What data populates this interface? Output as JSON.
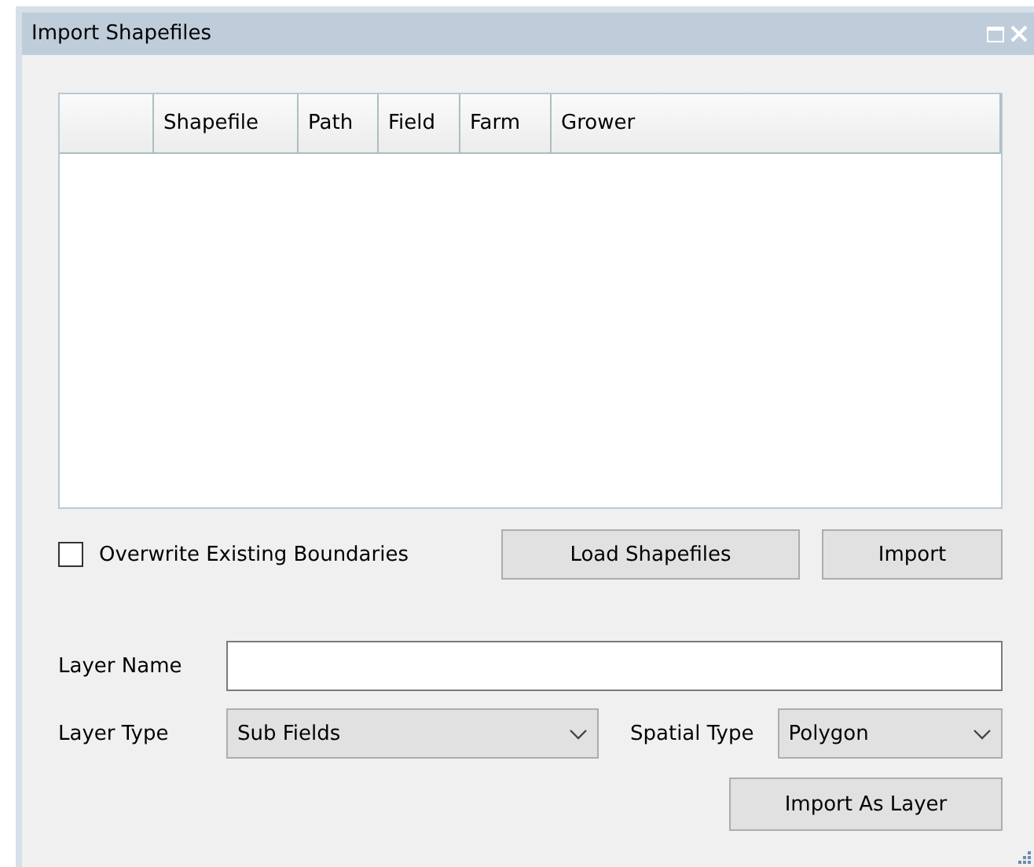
{
  "window": {
    "title": "Import Shapefiles"
  },
  "table": {
    "columns": [
      "Shapefile",
      "Path",
      "Field",
      "Farm",
      "Grower"
    ]
  },
  "overwrite": {
    "label": "Overwrite Existing Boundaries",
    "checked": false
  },
  "buttons": {
    "load": "Load Shapefiles",
    "import": "Import"
  },
  "layer_name": {
    "label": "Layer Name"
  },
  "layer_type": {
    "label": "Layer Type",
    "value": "Sub Fields"
  },
  "spatial_type": {
    "label": "Spatial Type",
    "value": "Polygon"
  },
  "import_as_layer": "Import As Layer"
}
